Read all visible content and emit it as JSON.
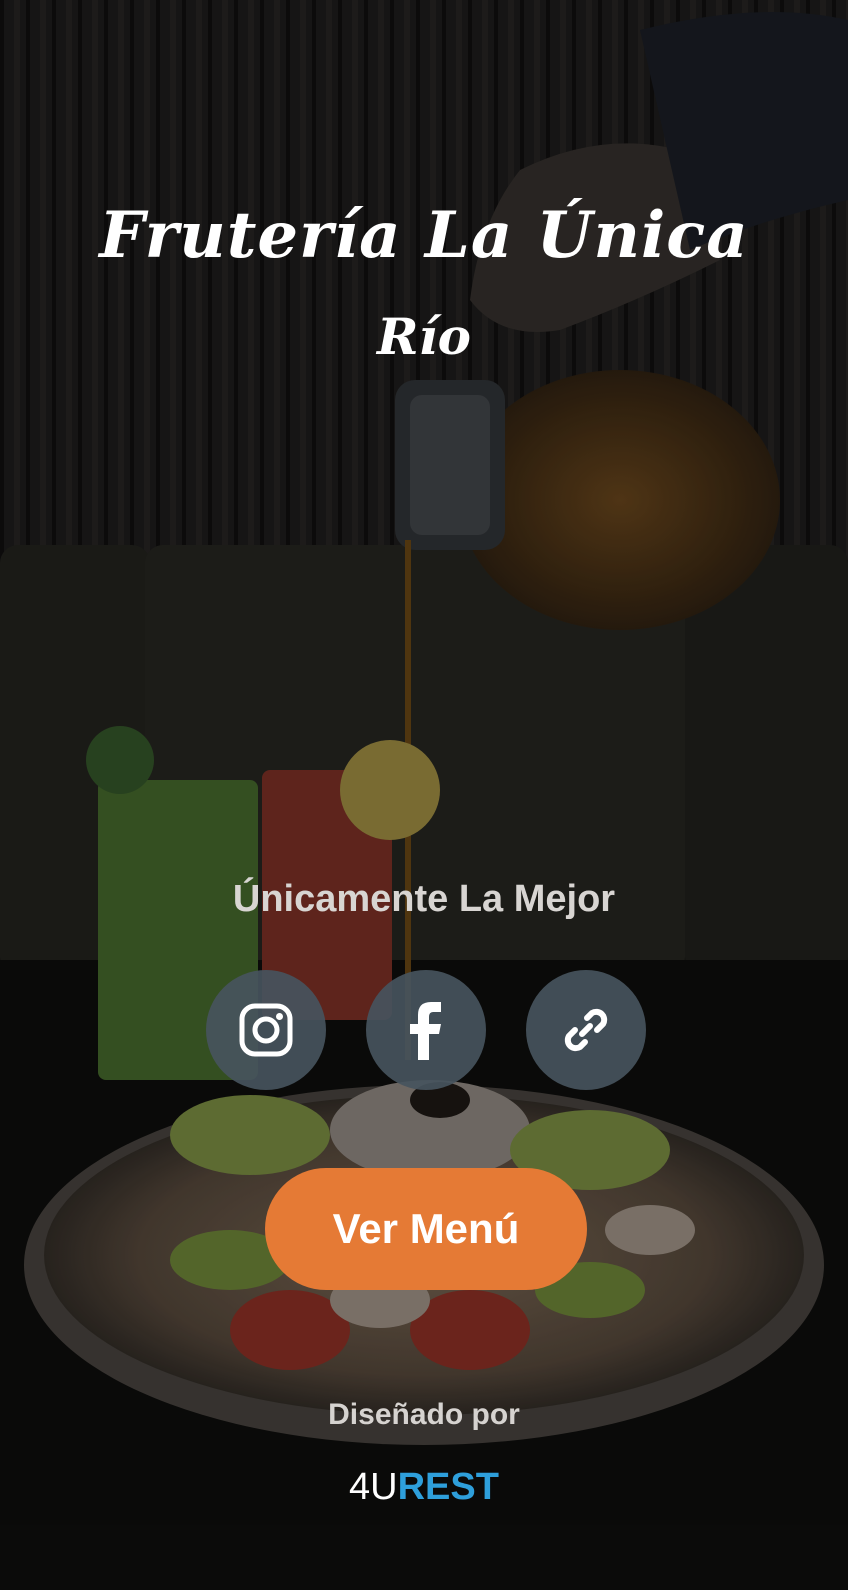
{
  "colors": {
    "accent": "#e57a35",
    "social_bg": "#46545d",
    "brand_blue": "#2e9fdb",
    "text_light": "#d8d5d2"
  },
  "background": {
    "image": "restaurant-photo-pouring-syrup-over-fruit-plate-with-juices"
  },
  "header": {
    "title": "Frutería La Única",
    "subtitle": "Río"
  },
  "slogan": "Únicamente La Mejor",
  "socials": [
    {
      "icon": "instagram-icon"
    },
    {
      "icon": "facebook-icon"
    },
    {
      "icon": "link-icon"
    }
  ],
  "menu_button": {
    "label": "Ver Menú"
  },
  "footer": {
    "designed_by": "Diseñado por",
    "brand_part1": "4U",
    "brand_part2": "REST"
  }
}
